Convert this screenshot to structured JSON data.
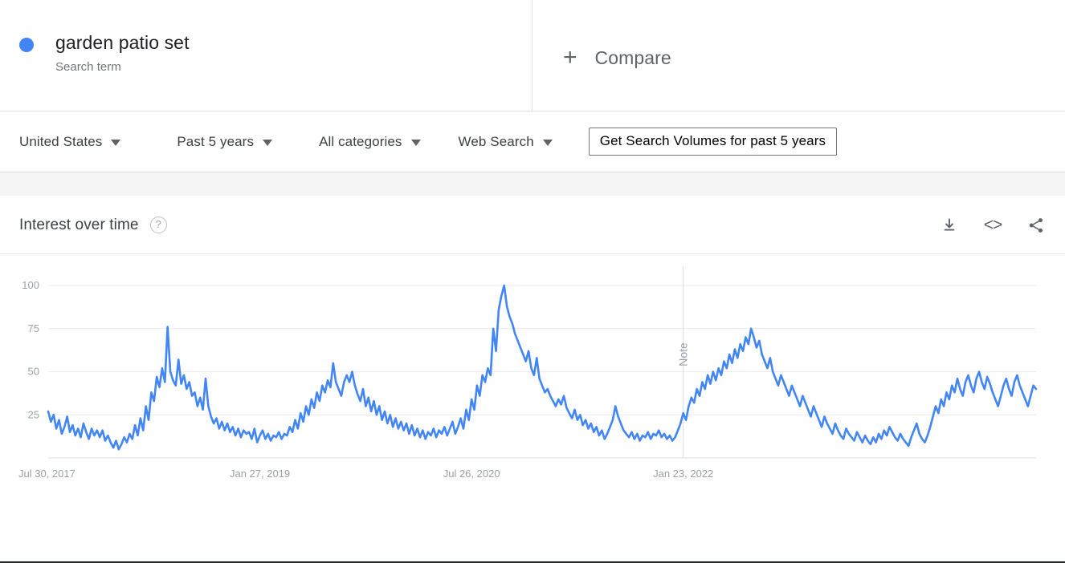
{
  "term": {
    "name": "garden patio set",
    "subtitle": "Search term",
    "dot_color": "#4285F4"
  },
  "compare": {
    "plus_glyph": "+",
    "label": "Compare"
  },
  "filters": [
    {
      "label": "United States",
      "icon": "chevron-down-icon"
    },
    {
      "label": "Past 5 years",
      "icon": "chevron-down-icon"
    },
    {
      "label": "All categories",
      "icon": "chevron-down-icon"
    },
    {
      "label": "Web Search",
      "icon": "chevron-down-icon"
    }
  ],
  "actions": {
    "volumes_button": "Get Search Volumes for past 5 years"
  },
  "card": {
    "title": "Interest over time",
    "help_glyph": "?",
    "icons": [
      {
        "name": "download-icon"
      },
      {
        "name": "embed-code-icon",
        "glyph": "<>"
      },
      {
        "name": "share-icon"
      }
    ]
  },
  "chart_data": {
    "type": "line",
    "title": "Interest over time",
    "xlabel": "",
    "ylabel": "",
    "ylim": [
      0,
      100
    ],
    "yticks": [
      25,
      50,
      75,
      100
    ],
    "grid": true,
    "legend": "none",
    "line_color": "#4285F4",
    "annotations": [
      {
        "label": "Note",
        "x_index": 234,
        "orientation": "vertical"
      }
    ],
    "xtick_labels": [
      "Jul 30, 2017",
      "Jan 27, 2019",
      "Jul 26, 2020",
      "Jan 23, 2022"
    ],
    "xtick_indices": [
      0,
      78,
      156,
      234
    ],
    "series": [
      {
        "name": "garden patio set",
        "values": [
          27,
          21,
          25,
          17,
          22,
          14,
          18,
          24,
          15,
          19,
          13,
          17,
          12,
          20,
          15,
          11,
          17,
          13,
          16,
          12,
          16,
          10,
          13,
          9,
          6,
          10,
          5,
          8,
          12,
          9,
          14,
          11,
          19,
          13,
          23,
          16,
          30,
          22,
          38,
          33,
          47,
          41,
          52,
          44,
          76,
          50,
          45,
          42,
          57,
          43,
          48,
          40,
          44,
          36,
          38,
          30,
          35,
          28,
          46,
          30,
          24,
          20,
          23,
          17,
          21,
          16,
          20,
          15,
          18,
          13,
          17,
          12,
          16,
          14,
          15,
          11,
          17,
          9,
          13,
          16,
          11,
          14,
          10,
          13,
          12,
          15,
          11,
          14,
          13,
          18,
          15,
          22,
          17,
          26,
          21,
          30,
          25,
          34,
          29,
          38,
          33,
          42,
          38,
          45,
          41,
          55,
          44,
          40,
          36,
          44,
          48,
          44,
          50,
          42,
          37,
          33,
          40,
          30,
          35,
          27,
          33,
          25,
          30,
          22,
          27,
          20,
          25,
          18,
          23,
          17,
          21,
          16,
          20,
          14,
          19,
          13,
          17,
          12,
          16,
          11,
          15,
          13,
          17,
          12,
          16,
          14,
          18,
          13,
          17,
          21,
          14,
          18,
          23,
          17,
          28,
          22,
          34,
          28,
          42,
          36,
          48,
          44,
          52,
          48,
          75,
          62,
          86,
          94,
          100,
          88,
          82,
          78,
          72,
          68,
          64,
          60,
          56,
          62,
          52,
          48,
          58,
          46,
          42,
          38,
          40,
          36,
          33,
          30,
          34,
          31,
          36,
          29,
          26,
          23,
          28,
          22,
          25,
          19,
          22,
          17,
          20,
          15,
          18,
          13,
          16,
          11,
          14,
          18,
          22,
          30,
          24,
          20,
          16,
          14,
          12,
          15,
          11,
          14,
          10,
          13,
          12,
          15,
          11,
          14,
          13,
          16,
          12,
          14,
          11,
          13,
          10,
          12,
          16,
          20,
          26,
          22,
          30,
          35,
          32,
          40,
          36,
          44,
          40,
          48,
          43,
          50,
          45,
          52,
          48,
          56,
          52,
          60,
          55,
          63,
          58,
          66,
          62,
          70,
          66,
          75,
          70,
          64,
          68,
          60,
          56,
          52,
          58,
          50,
          46,
          42,
          48,
          44,
          40,
          36,
          42,
          38,
          34,
          30,
          36,
          32,
          28,
          24,
          30,
          26,
          22,
          18,
          24,
          20,
          17,
          14,
          20,
          16,
          13,
          11,
          17,
          14,
          12,
          10,
          15,
          12,
          9,
          13,
          10,
          8,
          12,
          9,
          14,
          11,
          16,
          13,
          18,
          15,
          12,
          10,
          14,
          11,
          9,
          7,
          12,
          16,
          20,
          14,
          11,
          9,
          13,
          18,
          24,
          30,
          26,
          34,
          30,
          38,
          34,
          42,
          38,
          46,
          40,
          36,
          44,
          48,
          42,
          38,
          46,
          50,
          44,
          40,
          47,
          43,
          38,
          34,
          30,
          36,
          42,
          46,
          40,
          36,
          44,
          48,
          42,
          38,
          34,
          30,
          36,
          42,
          40
        ]
      }
    ]
  }
}
